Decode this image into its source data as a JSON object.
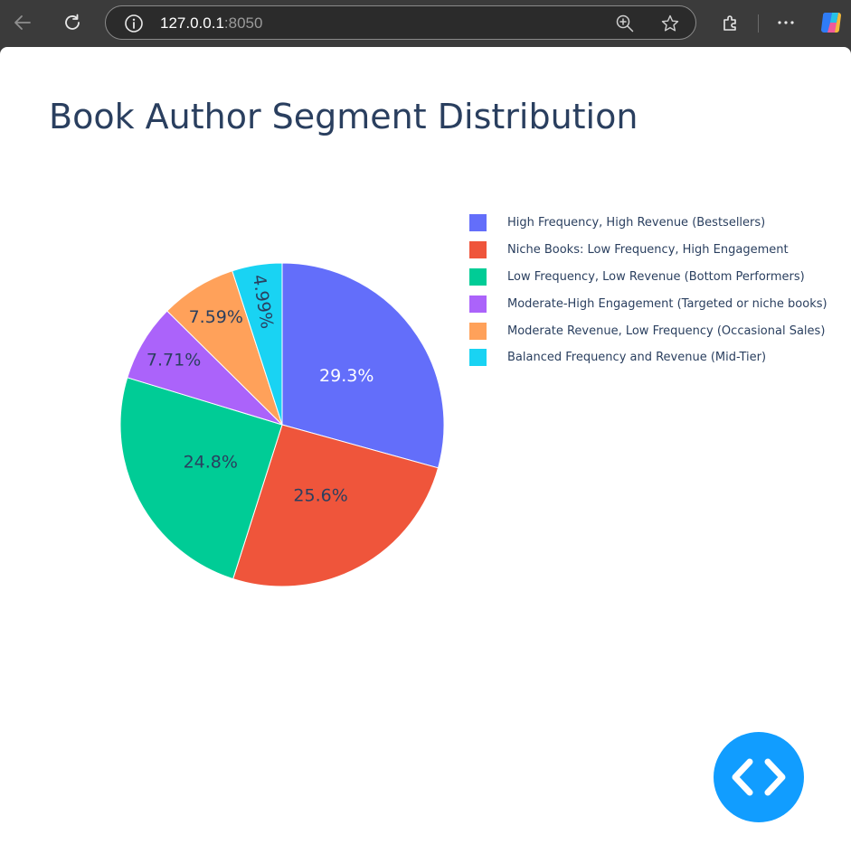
{
  "browser": {
    "url_host": "127.0.0.1",
    "url_port": ":8050",
    "icons": [
      "back-icon",
      "reload-icon",
      "info-icon",
      "zoom-icon",
      "star-icon",
      "extensions-icon",
      "more-icon",
      "copilot-icon"
    ]
  },
  "page": {
    "title": "Book Author Segment Distribution"
  },
  "chart_data": {
    "type": "pie",
    "title": "Book Author Segment Distribution",
    "labels": [
      "High Frequency, High Revenue (Bestsellers)",
      "Niche Books: Low Frequency, High Engagement",
      "Low Frequency, Low Revenue (Bottom Performers)",
      "Moderate-High Engagement (Targeted or niche books)",
      "Moderate Revenue, Low Frequency (Occasional Sales)",
      "Balanced Frequency and Revenue (Mid-Tier)"
    ],
    "values": [
      29.3,
      25.6,
      24.8,
      7.71,
      7.59,
      4.99
    ],
    "text_labels": [
      "29.3%",
      "25.6%",
      "24.8%",
      "7.71%",
      "7.59%",
      "4.99%"
    ],
    "colors": [
      "#636efa",
      "#ef553b",
      "#00cc96",
      "#ab63fa",
      "#ffa15a",
      "#19d3f3"
    ],
    "label_colors": [
      "#ffffff",
      "#2a3f5f",
      "#2a3f5f",
      "#2a3f5f",
      "#2a3f5f",
      "#2a3f5f"
    ],
    "direction": "clockwise",
    "start_angle": "top",
    "legend_position": "top-right"
  },
  "fab": {
    "icon": "code-brackets-icon",
    "color": "#119dff"
  }
}
